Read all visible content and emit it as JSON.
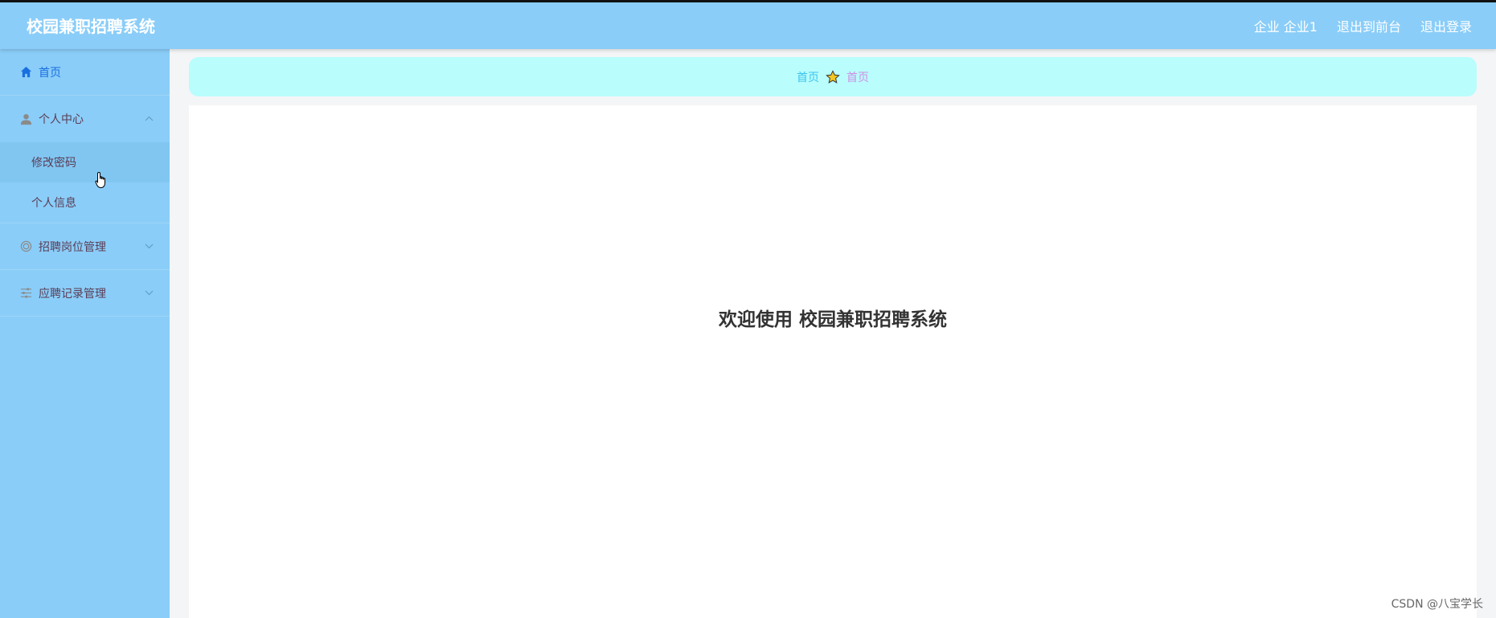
{
  "app": {
    "title": "校园兼职招聘系统"
  },
  "header": {
    "user": "企业 企业1",
    "to_front": "退出到前台",
    "logout": "退出登录"
  },
  "sidebar": {
    "home": {
      "label": "首页",
      "icon": "home-icon"
    },
    "personal": {
      "label": "个人中心",
      "icon": "user-icon",
      "expanded": true,
      "children": [
        "修改密码",
        "个人信息"
      ]
    },
    "jobs": {
      "label": "招聘岗位管理",
      "icon": "target-icon"
    },
    "applications": {
      "label": "应聘记录管理",
      "icon": "sliders-icon"
    }
  },
  "breadcrumb": {
    "first": "首页",
    "separator_icon": "star-icon",
    "last": "首页"
  },
  "main": {
    "welcome": "欢迎使用 校园兼职招聘系统"
  },
  "watermark": "CSDN @八宝学长",
  "colors": {
    "header_bg": "#8acdf8",
    "sidebar_bg": "#8acdf8",
    "breadcrumb_bg": "#b9fdfd",
    "active_text": "#1a6fe0"
  }
}
